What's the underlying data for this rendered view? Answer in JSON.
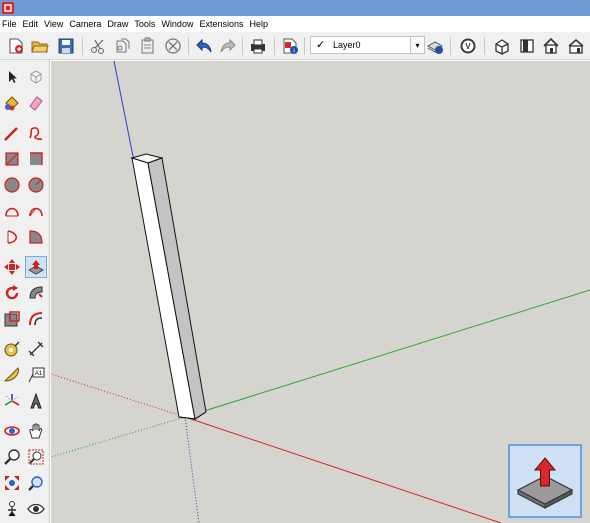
{
  "menubar": {
    "items": [
      "File",
      "Edit",
      "View",
      "Camera",
      "Draw",
      "Tools",
      "Window",
      "Extensions",
      "Help"
    ]
  },
  "toolbar": {
    "tools": [
      "new-file",
      "open",
      "save",
      "cut",
      "copy",
      "paste",
      "erase",
      "undo",
      "redo",
      "print",
      "model-info"
    ],
    "layer": {
      "check": "✓",
      "name": "Layer0"
    },
    "right_tools": [
      "layer-manager",
      "vray",
      "standard-views-iso",
      "front-view",
      "top-view",
      "right-view"
    ]
  },
  "left_toolbar": {
    "tools": [
      "select",
      "component",
      "paint-bucket",
      "eraser",
      "line",
      "freehand",
      "rectangle",
      "rotated-rectangle",
      "circle",
      "polygon",
      "arc",
      "two-point-arc",
      "three-point-arc",
      "pie",
      "move",
      "push-pull",
      "rotate",
      "follow-me",
      "scale",
      "offset",
      "tape-measure",
      "dimension",
      "protractor",
      "text",
      "axes",
      "3d-text",
      "orbit",
      "pan",
      "zoom",
      "zoom-window",
      "zoom-extents",
      "zoom-previous",
      "position-camera",
      "look-around"
    ],
    "active_tool": "push-pull"
  },
  "colors": {
    "titlebar": "#6b9bd1",
    "viewport_bg": "#d6d4ce",
    "axis_red": "#cc2b2b",
    "axis_green": "#2aa82a",
    "axis_blue": "#2a3fd0",
    "nav_widget_bg": "#cfe0f5",
    "nav_widget_border": "#6fa2dc"
  }
}
